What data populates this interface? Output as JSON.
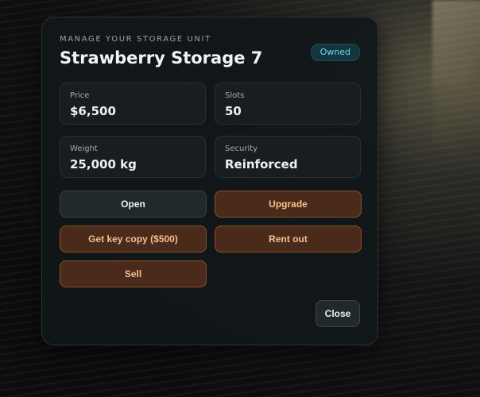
{
  "header": {
    "eyebrow": "MANAGE YOUR STORAGE UNIT",
    "title": "Strawberry Storage 7",
    "badge": "Owned"
  },
  "stats": [
    {
      "label": "Price",
      "value": "$6,500"
    },
    {
      "label": "Slots",
      "value": "50"
    },
    {
      "label": "Weight",
      "value": "25,000 kg"
    },
    {
      "label": "Security",
      "value": "Reinforced"
    }
  ],
  "actions": {
    "open": "Open",
    "upgrade": "Upgrade",
    "key_copy": "Get key copy ($500)",
    "rent_out": "Rent out",
    "sell": "Sell",
    "close": "Close"
  },
  "colors": {
    "accent_warm": "#4a2a1a",
    "accent_warm_border": "#8b5026",
    "accent_warm_text": "#f3c08d",
    "badge_bg": "#123640",
    "badge_text": "#7cd6ea"
  }
}
